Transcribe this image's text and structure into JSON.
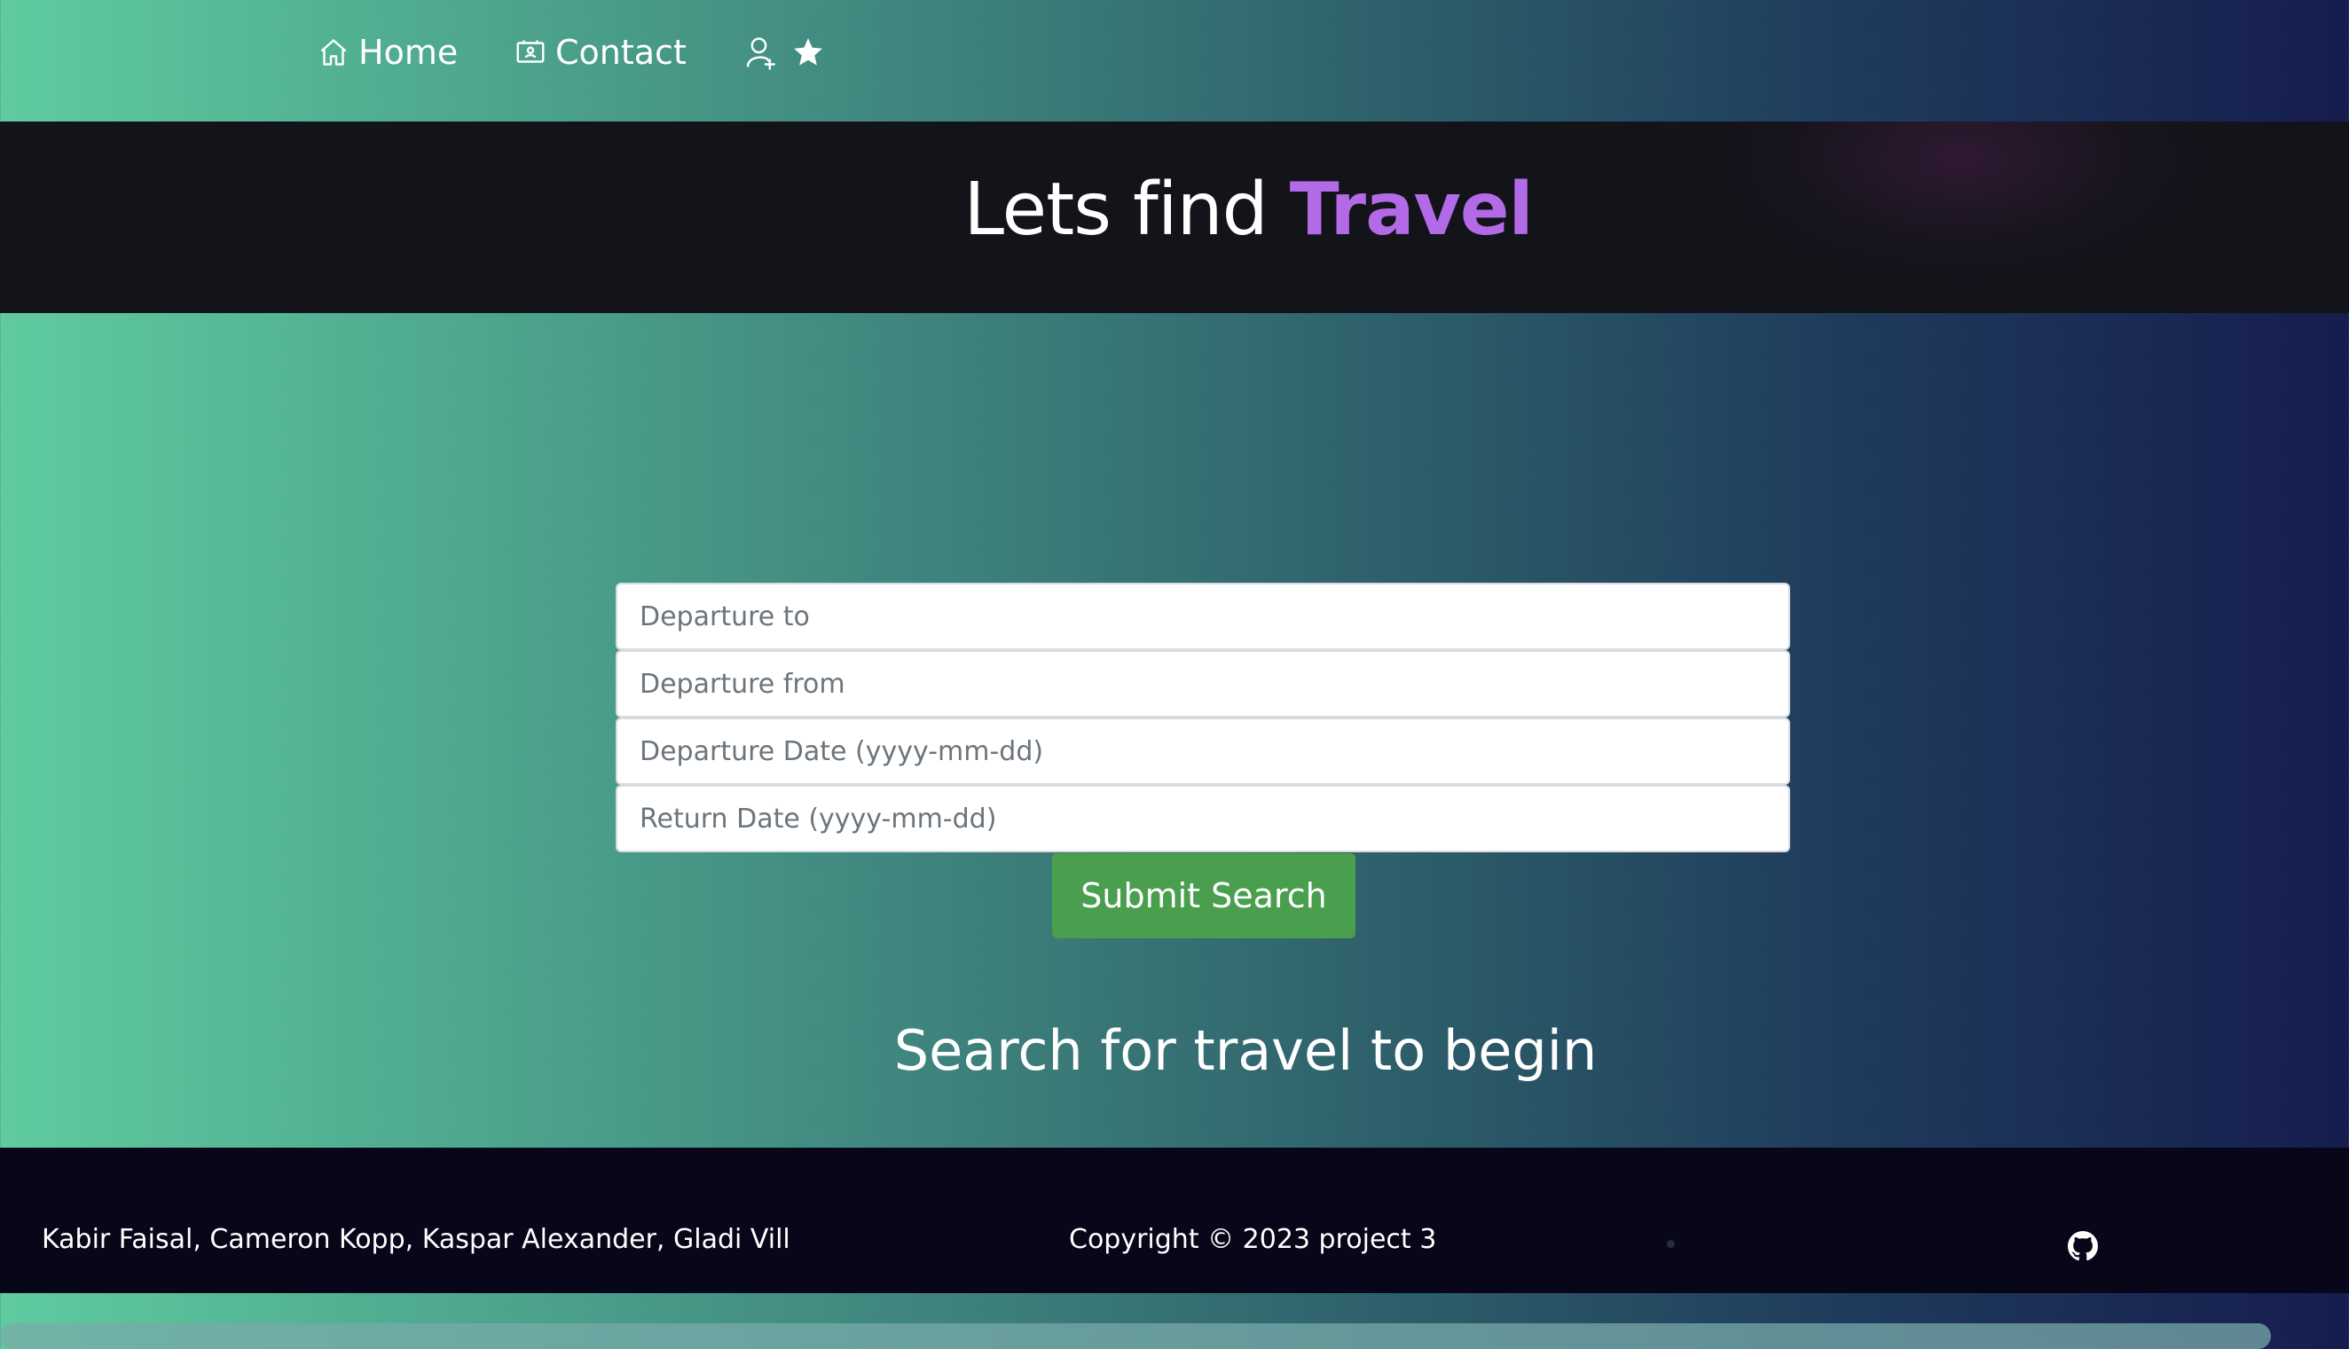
{
  "nav": {
    "home_label": "Home",
    "contact_label": "Contact",
    "icons": [
      "home-icon",
      "contact-card-icon",
      "user-add-icon",
      "star-icon"
    ]
  },
  "hero": {
    "title_prefix": "Lets find ",
    "title_accent": "Travel",
    "accent_color": "#b36ae6"
  },
  "search_form": {
    "departure_to_placeholder": "Departure to",
    "departure_from_placeholder": "Departure from",
    "departure_date_placeholder": "Departure Date (yyyy-mm-dd)",
    "return_date_placeholder": "Return Date (yyyy-mm-dd)",
    "submit_label": "Submit Search",
    "submit_color": "#4a9f4f"
  },
  "results": {
    "empty_message": "Search for travel to begin"
  },
  "footer": {
    "authors": "Kabir Faisal, Cameron Kopp, Kaspar Alexander, Gladi Vill",
    "copyright": "Copyright © 2023 project 3",
    "github_icon": "github-icon"
  },
  "colors": {
    "gradient_start": "#5fcb9f",
    "gradient_end": "#161d4e",
    "hero_bg": "#131419",
    "footer_bg": "#080619"
  }
}
